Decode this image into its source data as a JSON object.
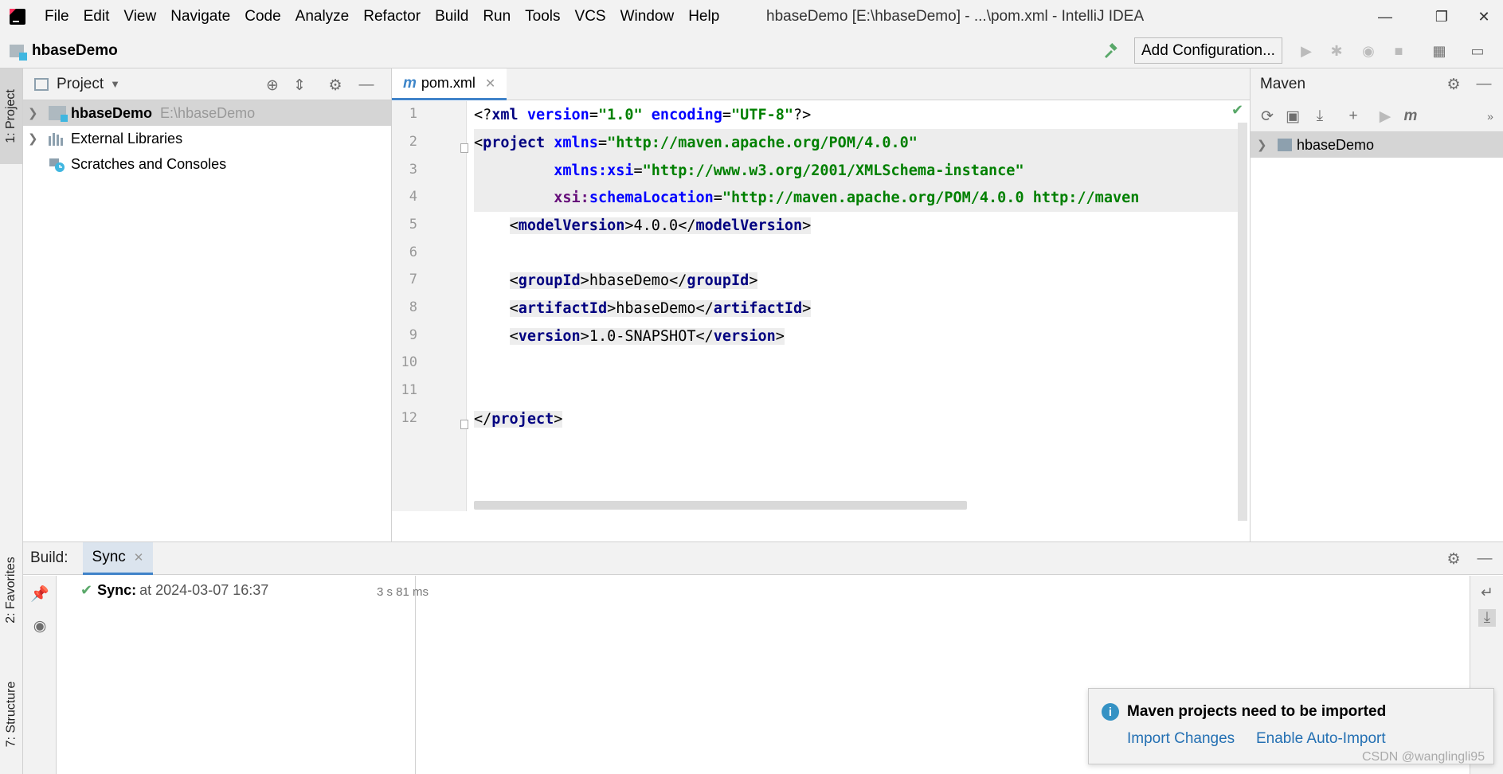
{
  "window": {
    "title": "hbaseDemo [E:\\hbaseDemo] - ...\\pom.xml - IntelliJ IDEA",
    "minimize": "—",
    "restore": "❐",
    "close": "✕"
  },
  "menu": [
    "File",
    "Edit",
    "View",
    "Navigate",
    "Code",
    "Analyze",
    "Refactor",
    "Build",
    "Run",
    "Tools",
    "VCS",
    "Window",
    "Help"
  ],
  "navbar": {
    "project_name": "hbaseDemo",
    "run_config_label": "Add Configuration..."
  },
  "left_strip": {
    "project_tab": "1: Project",
    "favorites_tab": "2: Favorites",
    "structure_tab": "7: Structure"
  },
  "project_panel": {
    "title": "Project",
    "tree": [
      {
        "label": "hbaseDemo",
        "sub": "E:\\hbaseDemo",
        "icon": "module-folder-icon"
      },
      {
        "label": "External Libraries",
        "icon": "libraries-icon"
      },
      {
        "label": "Scratches and Consoles",
        "icon": "scratches-icon"
      }
    ]
  },
  "editor": {
    "tab_prefix": "m",
    "tab_name": "pom.xml",
    "line_numbers": [
      "1",
      "2",
      "3",
      "4",
      "5",
      "6",
      "7",
      "8",
      "9",
      "10",
      "11",
      "12"
    ],
    "code": {
      "l1_attr1": "version",
      "l1_val1": "\"1.0\"",
      "l1_attr2": "encoding",
      "l1_val2": "\"UTF-8\"",
      "project_tag": "project",
      "xmlns": "xmlns",
      "xmlns_val": "\"http://maven.apache.org/POM/4.0.0\"",
      "xmlns_prefix": "xmlns",
      "xsi": "xsi",
      "xsi_val": "\"http://www.w3.org/2001/XMLSchema-instance\"",
      "schema_prefix": "xsi",
      "schema_attr": "schemaLocation",
      "schema_val": "\"http://maven.apache.org/POM/4.0.0 http://maven",
      "model_tag": "modelVersion",
      "model_val": "4.0.0",
      "group_tag": "groupId",
      "group_val": "hbaseDemo",
      "artifact_tag": "artifactId",
      "artifact_val": "hbaseDemo",
      "version_tag": "version",
      "version_val": "1.0-SNAPSHOT"
    }
  },
  "maven_panel": {
    "title": "Maven",
    "project": "hbaseDemo"
  },
  "build_panel": {
    "label": "Build:",
    "tab": "Sync",
    "sync_label": "Sync:",
    "sync_time": "at 2024-03-07 16:37",
    "sync_duration": "3 s 81 ms"
  },
  "notification": {
    "title": "Maven projects need to be imported",
    "import_changes": "Import Changes",
    "enable_auto_import": "Enable Auto-Import"
  },
  "watermark": "CSDN @wanglingli95",
  "colors": {
    "accent": "#4083c9",
    "link": "#2470b3",
    "success": "#59a869"
  }
}
